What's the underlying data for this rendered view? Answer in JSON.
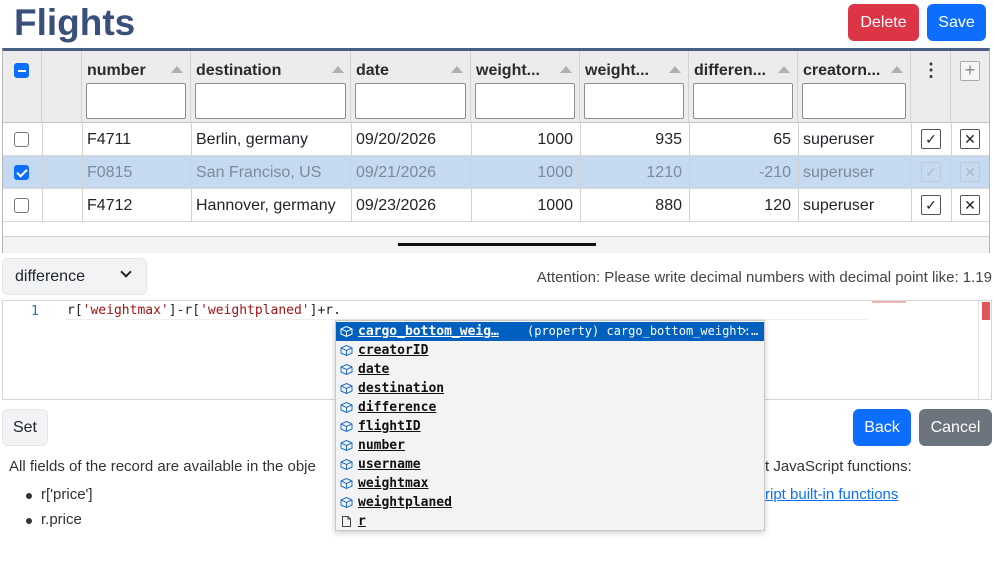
{
  "page": {
    "title": "Flights"
  },
  "toolbar": {
    "delete_label": "Delete",
    "save_label": "Save"
  },
  "grid": {
    "columns": [
      "number",
      "destination",
      "date",
      "weight...",
      "weight...",
      "differen...",
      "creatorn..."
    ],
    "rows": [
      {
        "checked": false,
        "number": "F4711",
        "destination": "Berlin, germany",
        "date": "09/20/2026",
        "weightmax": "1000",
        "weightplaned": "935",
        "difference": "65",
        "creator": "superuser"
      },
      {
        "checked": true,
        "number": "F0815",
        "destination": "San Franciso, US",
        "date": "09/21/2026",
        "weightmax": "1000",
        "weightplaned": "1210",
        "difference": "-210",
        "creator": "superuser"
      },
      {
        "checked": false,
        "number": "F4712",
        "destination": "Hannover, germany",
        "date": "09/23/2026",
        "weightmax": "1000",
        "weightplaned": "880",
        "difference": "120",
        "creator": "superuser"
      }
    ],
    "menu_glyph": "⋮",
    "add_glyph": "+"
  },
  "column_select": {
    "value": "difference"
  },
  "attention": "Attention: Please write decimal numbers with decimal point like: 1.19",
  "editor": {
    "line_number": "1",
    "code_parts": [
      "r[",
      "'weightmax'",
      "]-r[",
      "'weightplaned'",
      "]+r."
    ]
  },
  "suggest": {
    "items": [
      {
        "label": "cargo_bottom_weig…",
        "kind": "property",
        "detail": "(property) cargo_bottom_weight:…",
        "active": true
      },
      {
        "label": "creatorID",
        "kind": "property"
      },
      {
        "label": "date",
        "kind": "property"
      },
      {
        "label": "destination",
        "kind": "property"
      },
      {
        "label": "difference",
        "kind": "property"
      },
      {
        "label": "flightID",
        "kind": "property"
      },
      {
        "label": "number",
        "kind": "property"
      },
      {
        "label": "username",
        "kind": "property"
      },
      {
        "label": "weightmax",
        "kind": "property"
      },
      {
        "label": "weightplaned",
        "kind": "property"
      },
      {
        "label": "r",
        "kind": "variable"
      }
    ]
  },
  "actions": {
    "set_label": "Set",
    "back_label": "Back",
    "cancel_label": "Cancel"
  },
  "help": {
    "left_text": "All fields of the record are available in the obje",
    "right_text": "t JavaScript functions:",
    "link_text": "ript built-in functions",
    "bullets": [
      "r['price']",
      "r.price"
    ]
  },
  "colors": {
    "primary": "#0d6efd",
    "danger": "#dc3545",
    "secondary": "#6c757d",
    "title": "#3a4f7a",
    "selected_row": "#c5d9f1"
  }
}
